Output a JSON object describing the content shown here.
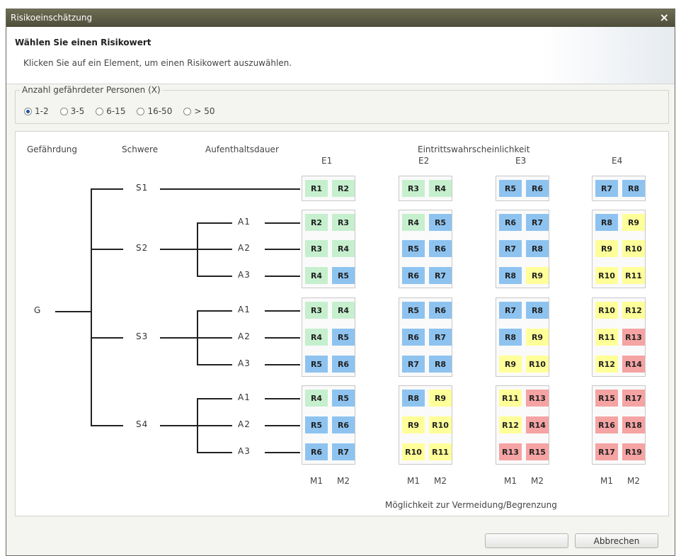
{
  "dialog": {
    "title": "Risikoeinschätzung",
    "close_symbol": "×"
  },
  "header": {
    "title": "Wählen Sie einen Risikowert",
    "subtitle": "Klicken Sie auf ein Element, um einen Risikowert auszuwählen."
  },
  "persons": {
    "legend": "Anzahl gefährdeter Personen (X)",
    "options": [
      "1-2",
      "3-5",
      "6-15",
      "16-50",
      "> 50"
    ],
    "selected_index": 0
  },
  "graph": {
    "col_headers": {
      "hazard": "Gefährdung",
      "severity": "Schwere",
      "duration": "Aufenthaltsdauer",
      "probability": "Eintrittswahrscheinlichkeit"
    },
    "root": "G",
    "e_labels": [
      "E1",
      "E2",
      "E3",
      "E4"
    ],
    "m_labels": [
      "M1",
      "M2"
    ],
    "footer": "Möglichkeit zur Vermeidung/Begrenzung",
    "severities": [
      {
        "label": "S1",
        "durations": []
      },
      {
        "label": "S2",
        "durations": [
          "A1",
          "A2",
          "A3"
        ]
      },
      {
        "label": "S3",
        "durations": [
          "A1",
          "A2",
          "A3"
        ]
      },
      {
        "label": "S4",
        "durations": [
          "A1",
          "A2",
          "A3"
        ]
      }
    ],
    "rows": [
      [
        "R1",
        "R2",
        "R3",
        "R4",
        "R5",
        "R6",
        "R7",
        "R8"
      ],
      [
        "R2",
        "R3",
        "R4",
        "R5",
        "R6",
        "R7",
        "R8",
        "R9"
      ],
      [
        "R3",
        "R4",
        "R5",
        "R6",
        "R7",
        "R8",
        "R9",
        "R10"
      ],
      [
        "R4",
        "R5",
        "R6",
        "R7",
        "R8",
        "R9",
        "R10",
        "R11"
      ],
      [
        "R3",
        "R4",
        "R5",
        "R6",
        "R7",
        "R8",
        "R10",
        "R12"
      ],
      [
        "R4",
        "R5",
        "R6",
        "R7",
        "R8",
        "R9",
        "R11",
        "R13"
      ],
      [
        "R5",
        "R6",
        "R7",
        "R8",
        "R9",
        "R10",
        "R12",
        "R14"
      ],
      [
        "R4",
        "R5",
        "R8",
        "R9",
        "R11",
        "R13",
        "R15",
        "R17"
      ],
      [
        "R5",
        "R6",
        "R9",
        "R10",
        "R12",
        "R14",
        "R16",
        "R18"
      ],
      [
        "R6",
        "R7",
        "R10",
        "R11",
        "R13",
        "R15",
        "R17",
        "R19"
      ]
    ],
    "colors": {
      "green": "#c6efce",
      "blue": "#8ec3f0",
      "yellow": "#ffff99",
      "red": "#f5a3a3"
    }
  },
  "buttons": {
    "ok": "",
    "cancel": "Abbrechen"
  }
}
